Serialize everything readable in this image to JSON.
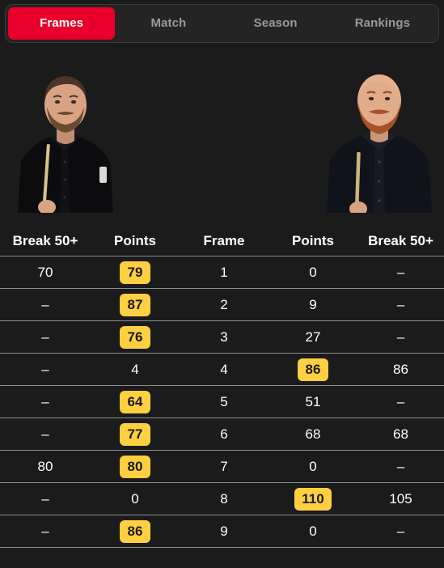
{
  "tabs": [
    {
      "label": "Frames",
      "active": true
    },
    {
      "label": "Match",
      "active": false
    },
    {
      "label": "Season",
      "active": false
    },
    {
      "label": "Rankings",
      "active": false
    }
  ],
  "players": {
    "left": {
      "name": "player-left-photo",
      "description": "snooker player, short brown hair, beard, black shirt, holding cue"
    },
    "right": {
      "name": "player-right-photo",
      "description": "snooker player, bald head, ginger beard, dark navy shirt with bow tie, holding cue"
    }
  },
  "table": {
    "headers": [
      "Break 50+",
      "Points",
      "Frame",
      "Points",
      "Break 50+"
    ],
    "rows": [
      {
        "break_left": "70",
        "points_left": "79",
        "points_left_hl": true,
        "frame": "1",
        "points_right": "0",
        "points_right_hl": false,
        "break_right": "–"
      },
      {
        "break_left": "–",
        "points_left": "87",
        "points_left_hl": true,
        "frame": "2",
        "points_right": "9",
        "points_right_hl": false,
        "break_right": "–"
      },
      {
        "break_left": "–",
        "points_left": "76",
        "points_left_hl": true,
        "frame": "3",
        "points_right": "27",
        "points_right_hl": false,
        "break_right": "–"
      },
      {
        "break_left": "–",
        "points_left": "4",
        "points_left_hl": false,
        "frame": "4",
        "points_right": "86",
        "points_right_hl": true,
        "break_right": "86"
      },
      {
        "break_left": "–",
        "points_left": "64",
        "points_left_hl": true,
        "frame": "5",
        "points_right": "51",
        "points_right_hl": false,
        "break_right": "–"
      },
      {
        "break_left": "–",
        "points_left": "77",
        "points_left_hl": true,
        "frame": "6",
        "points_right": "68",
        "points_right_hl": false,
        "break_right": "68"
      },
      {
        "break_left": "80",
        "points_left": "80",
        "points_left_hl": true,
        "frame": "7",
        "points_right": "0",
        "points_right_hl": false,
        "break_right": "–"
      },
      {
        "break_left": "–",
        "points_left": "0",
        "points_left_hl": false,
        "frame": "8",
        "points_right": "110",
        "points_right_hl": true,
        "break_right": "105"
      },
      {
        "break_left": "–",
        "points_left": "86",
        "points_left_hl": true,
        "frame": "9",
        "points_right": "0",
        "points_right_hl": false,
        "break_right": "–"
      }
    ]
  },
  "colors": {
    "background": "#1b1b1b",
    "accent_red": "#e8002a",
    "highlight_yellow": "#fdcf41",
    "inactive_tab_text": "#9a9a9a",
    "divider": "#8f8f8f"
  }
}
